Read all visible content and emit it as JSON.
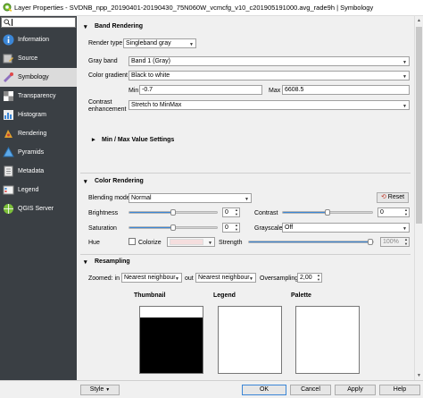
{
  "window": {
    "title": "Layer Properties - SVDNB_npp_20190401-20190430_75N060W_vcmcfg_v10_c201905191000.avg_rade9h | Symbology"
  },
  "sidebar": {
    "search_value": "",
    "items": [
      {
        "label": "Information",
        "icon": "info-icon"
      },
      {
        "label": "Source",
        "icon": "source-icon"
      },
      {
        "label": "Symbology",
        "icon": "symbology-icon"
      },
      {
        "label": "Transparency",
        "icon": "transparency-icon"
      },
      {
        "label": "Histogram",
        "icon": "histogram-icon"
      },
      {
        "label": "Rendering",
        "icon": "rendering-icon"
      },
      {
        "label": "Pyramids",
        "icon": "pyramids-icon"
      },
      {
        "label": "Metadata",
        "icon": "metadata-icon"
      },
      {
        "label": "Legend",
        "icon": "legend-icon"
      },
      {
        "label": "QGIS Server",
        "icon": "server-icon"
      }
    ]
  },
  "band_rendering": {
    "header": "Band Rendering",
    "render_type_label": "Render type",
    "render_type_value": "Singleband gray",
    "gray_band_label": "Gray band",
    "gray_band_value": "Band 1 (Gray)",
    "color_gradient_label": "Color gradient",
    "color_gradient_value": "Black to white",
    "min_label": "Min",
    "min_value": "-0.7",
    "max_label": "Max",
    "max_value": "6608.5",
    "contrast_label_line1": "Contrast",
    "contrast_label_line2": "enhancement",
    "contrast_value": "Stretch to MinMax",
    "minmax_header": "Min / Max Value Settings"
  },
  "color_rendering": {
    "header": "Color Rendering",
    "blending_label": "Blending mode",
    "blending_value": "Normal",
    "reset_label": "Reset",
    "brightness_label": "Brightness",
    "brightness_value": "0",
    "brightness_level": 0.5,
    "contrast_label": "Contrast",
    "contrast_value": "0",
    "contrast_level": 0.5,
    "saturation_label": "Saturation",
    "saturation_value": "0",
    "saturation_level": 0.5,
    "grayscale_label": "Grayscale",
    "grayscale_value": "Off",
    "hue_label": "Hue",
    "colorize_label": "Colorize",
    "colorize_color": "#f5dede",
    "strength_label": "Strength",
    "strength_value": "100%",
    "strength_level": 1.0
  },
  "resampling": {
    "header": "Resampling",
    "zoomed_in_label": "Zoomed: in",
    "zoomed_in_value": "Nearest neighbour",
    "out_label": "out",
    "out_value": "Nearest neighbour",
    "oversampling_label": "Oversampling",
    "oversampling_value": "2,00"
  },
  "previews": {
    "thumbnail_label": "Thumbnail",
    "legend_label": "Legend",
    "palette_label": "Palette"
  },
  "buttons": {
    "style": "Style",
    "ok": "OK",
    "cancel": "Cancel",
    "apply": "Apply",
    "help": "Help"
  },
  "colors": {
    "sidebar_bg": "#3a3f44",
    "accent": "#3b86d6"
  }
}
